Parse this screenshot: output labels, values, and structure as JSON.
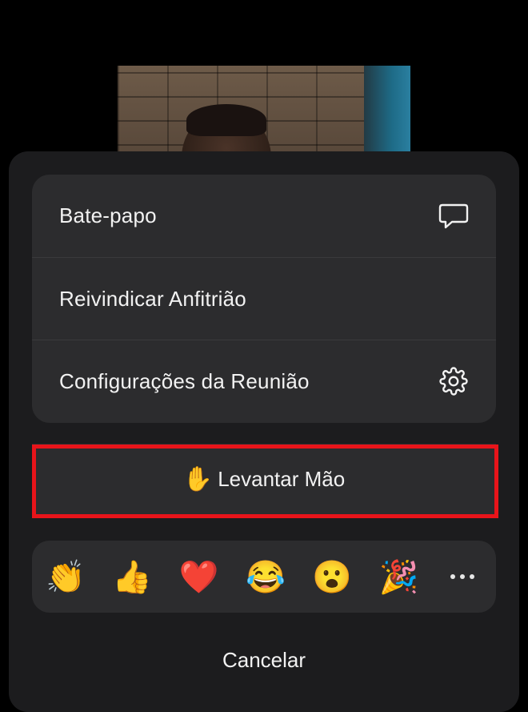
{
  "menu": {
    "items": [
      {
        "label": "Bate-papo",
        "icon": "chat-bubble-icon"
      },
      {
        "label": "Reivindicar Anfitrião",
        "icon": ""
      },
      {
        "label": "Configurações da Reunião",
        "icon": "gear-icon"
      }
    ]
  },
  "raise_hand": {
    "emoji": "✋",
    "label": "Levantar Mão"
  },
  "reactions": [
    {
      "emoji": "👏",
      "icon": "clapping-hands-icon"
    },
    {
      "emoji": "👍",
      "icon": "thumbs-up-icon"
    },
    {
      "emoji": "❤️",
      "icon": "heart-icon"
    },
    {
      "emoji": "😂",
      "icon": "tears-of-joy-icon"
    },
    {
      "emoji": "😮",
      "icon": "surprised-face-icon"
    },
    {
      "emoji": "🎉",
      "icon": "party-popper-icon"
    }
  ],
  "more_icon": "more-horizontal-icon",
  "cancel_label": "Cancelar",
  "colors": {
    "background": "#000000",
    "sheet": "#1c1c1e",
    "card": "#2c2c2e",
    "highlight": "#e8141a",
    "text": "#f2f2f2"
  }
}
